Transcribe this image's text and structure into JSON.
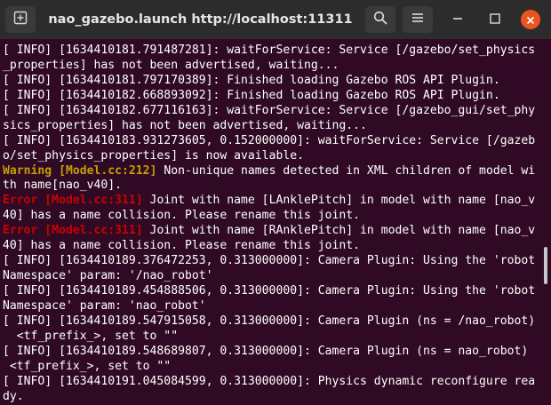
{
  "window": {
    "title": "nao_gazebo.launch http://localhost:11311"
  },
  "titlebar": {
    "icons": {
      "new_tab": "new-tab-icon",
      "search": "search-icon",
      "menu": "hamburger-menu-icon",
      "minimize": "minimize-icon",
      "maximize": "maximize-icon",
      "close": "close-icon"
    },
    "colors": {
      "close": "#e95420"
    }
  },
  "terminal": {
    "colors": {
      "background": "#300a24",
      "text": "#ffffff",
      "warning": "#c4a000",
      "error": "#cc0000"
    },
    "lines": [
      [
        {
          "text": "[ INFO] [1634410181.791487281]: waitForService: Service [/gazebo/set_physics",
          "style": "plain"
        }
      ],
      [
        {
          "text": "_properties] has not been advertised, waiting...",
          "style": "plain"
        }
      ],
      [
        {
          "text": "[ INFO] [1634410181.797170389]: Finished loading Gazebo ROS API Plugin.",
          "style": "plain"
        }
      ],
      [
        {
          "text": "[ INFO] [1634410182.668893092]: Finished loading Gazebo ROS API Plugin.",
          "style": "plain"
        }
      ],
      [
        {
          "text": "[ INFO] [1634410182.677116163]: waitForService: Service [/gazebo_gui/set_phy",
          "style": "plain"
        }
      ],
      [
        {
          "text": "sics_properties] has not been advertised, waiting...",
          "style": "plain"
        }
      ],
      [
        {
          "text": "[ INFO] [1634410183.931273605, 0.152000000]: waitForService: Service [/gazeb",
          "style": "plain"
        }
      ],
      [
        {
          "text": "o/set_physics_properties] is now available.",
          "style": "plain"
        }
      ],
      [
        {
          "text": "Warning [Model.cc:212]",
          "style": "warn"
        },
        {
          "text": " Non-unique names detected in XML children of model wi",
          "style": "plain"
        }
      ],
      [
        {
          "text": "th name[nao_v40].",
          "style": "plain"
        }
      ],
      [
        {
          "text": "Error [Model.cc:311]",
          "style": "err"
        },
        {
          "text": " Joint with name [LAnklePitch] in model with name [nao_v",
          "style": "plain"
        }
      ],
      [
        {
          "text": "40] has a name collision. Please rename this joint.",
          "style": "plain"
        }
      ],
      [
        {
          "text": "Error [Model.cc:311]",
          "style": "err"
        },
        {
          "text": " Joint with name [RAnklePitch] in model with name [nao_v",
          "style": "plain"
        }
      ],
      [
        {
          "text": "40] has a name collision. Please rename this joint.",
          "style": "plain"
        }
      ],
      [
        {
          "text": "[ INFO] [1634410189.376472253, 0.313000000]: Camera Plugin: Using the 'robot",
          "style": "plain"
        }
      ],
      [
        {
          "text": "Namespace' param: '/nao_robot'",
          "style": "plain"
        }
      ],
      [
        {
          "text": "[ INFO] [1634410189.454888506, 0.313000000]: Camera Plugin: Using the 'robot",
          "style": "plain"
        }
      ],
      [
        {
          "text": "Namespace' param: 'nao_robot'",
          "style": "plain"
        }
      ],
      [
        {
          "text": "[ INFO] [1634410189.547915058, 0.313000000]: Camera Plugin (ns = /nao_robot)",
          "style": "plain"
        }
      ],
      [
        {
          "text": "  <tf_prefix_>, set to \"\"",
          "style": "plain"
        }
      ],
      [
        {
          "text": "[ INFO] [1634410189.548689807, 0.313000000]: Camera Plugin (ns = nao_robot)",
          "style": "plain"
        }
      ],
      [
        {
          "text": " <tf_prefix_>, set to \"\"",
          "style": "plain"
        }
      ],
      [
        {
          "text": "[ INFO] [1634410191.045084599, 0.313000000]: Physics dynamic reconfigure rea",
          "style": "plain"
        }
      ],
      [
        {
          "text": "dy.",
          "style": "plain"
        }
      ]
    ]
  }
}
